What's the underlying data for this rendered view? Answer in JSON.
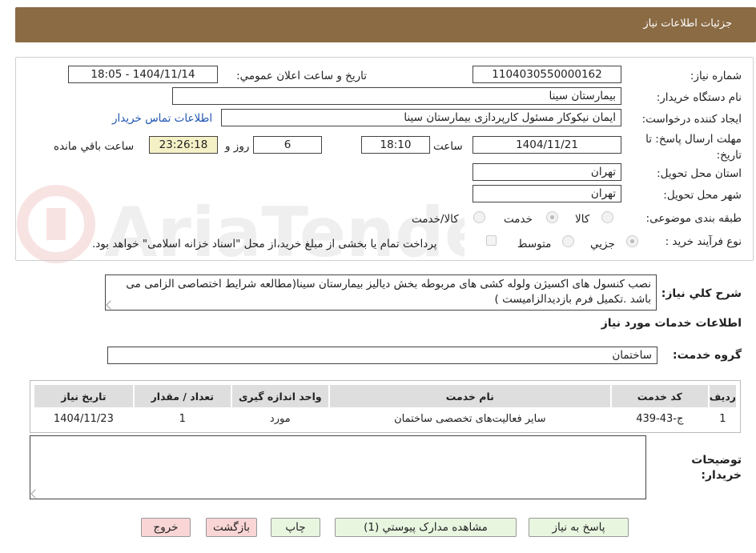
{
  "header": {
    "title": "جزئیات اطلاعات نیاز"
  },
  "form": {
    "need_number_label": "شماره نیاز:",
    "need_number": "1104030550000162",
    "announce_label": "تاریخ و ساعت اعلان عمومي:",
    "announce_value": "1404/11/14 - 18:05",
    "buyer_org_label": "نام دستگاه خريدار:",
    "buyer_org": "بيمارستان سينا",
    "requester_label": "ايجاد کننده درخواست:",
    "requester": "ايمان نيکوکار مسئول کارپردازی  بيمارستان سينا",
    "contact_link": "اطلاعات تماس خريدار",
    "deadline_label": "مهلت ارسال پاسخ: تا تاریخ:",
    "deadline_date": "1404/11/21",
    "time_label": "ساعت",
    "deadline_time": "18:10",
    "days_value": "6",
    "days_label": "روز و",
    "remaining_time": "23:26:18",
    "remaining_label": "ساعت باقي مانده",
    "province_label": "استان محل تحویل:",
    "province": "تهران",
    "city_label": "شهر محل تحویل:",
    "city": "تهران",
    "category_label": "طبقه بندی موضوعی:",
    "category_options": [
      "کالا",
      "خدمت",
      "کالا/خدمت"
    ],
    "category_selected": "خدمت",
    "process_label": "نوع فرآيند خريد :",
    "process_options": [
      "جزيي",
      "متوسط"
    ],
    "process_selected": "جزيي",
    "payment_note": "پرداخت تمام يا بخشی از مبلغ خريد،از محل \"اسناد خزانه اسلامی\" خواهد بود.",
    "description_label": "شرح کلي نياز:",
    "description": "نصب کنسول های اکسیژن ولوله کشی های مربوطه بخش دیالیز بیمارستان سینا(مطالعه شرایط اختصاصی الزامی می باشد .تکمیل فرم بازدیدالزامیست )",
    "services_title": "اطلاعات خدمات مورد نياز",
    "service_group_label": "گروه خدمت:",
    "service_group": "ساختمان",
    "notes_label": "توضيحات خريدار:",
    "notes": ""
  },
  "table": {
    "headers": [
      "رديف",
      "کد خدمت",
      "نام خدمت",
      "واحد اندازه گيری",
      "تعداد / مقدار",
      "تاريخ نياز"
    ],
    "rows": [
      [
        "1",
        "ج-43-439",
        "ساير فعاليت‌های تخصصی ساختمان",
        "مورد",
        "1",
        "1404/11/23"
      ]
    ]
  },
  "buttons": {
    "reply": "پاسخ به نياز",
    "attachments": "مشاهده مدارک پيوستي (1)",
    "print": "چاپ",
    "back": "بازگشت",
    "exit": "خروج"
  },
  "watermark": "AriaTender.neT",
  "colors": {
    "header": "#8a6b44",
    "link": "#1f55b0",
    "timer_bg": "#f5f1c6",
    "btn_green": "#e8f6e0",
    "btn_red": "#f9d5d5"
  }
}
